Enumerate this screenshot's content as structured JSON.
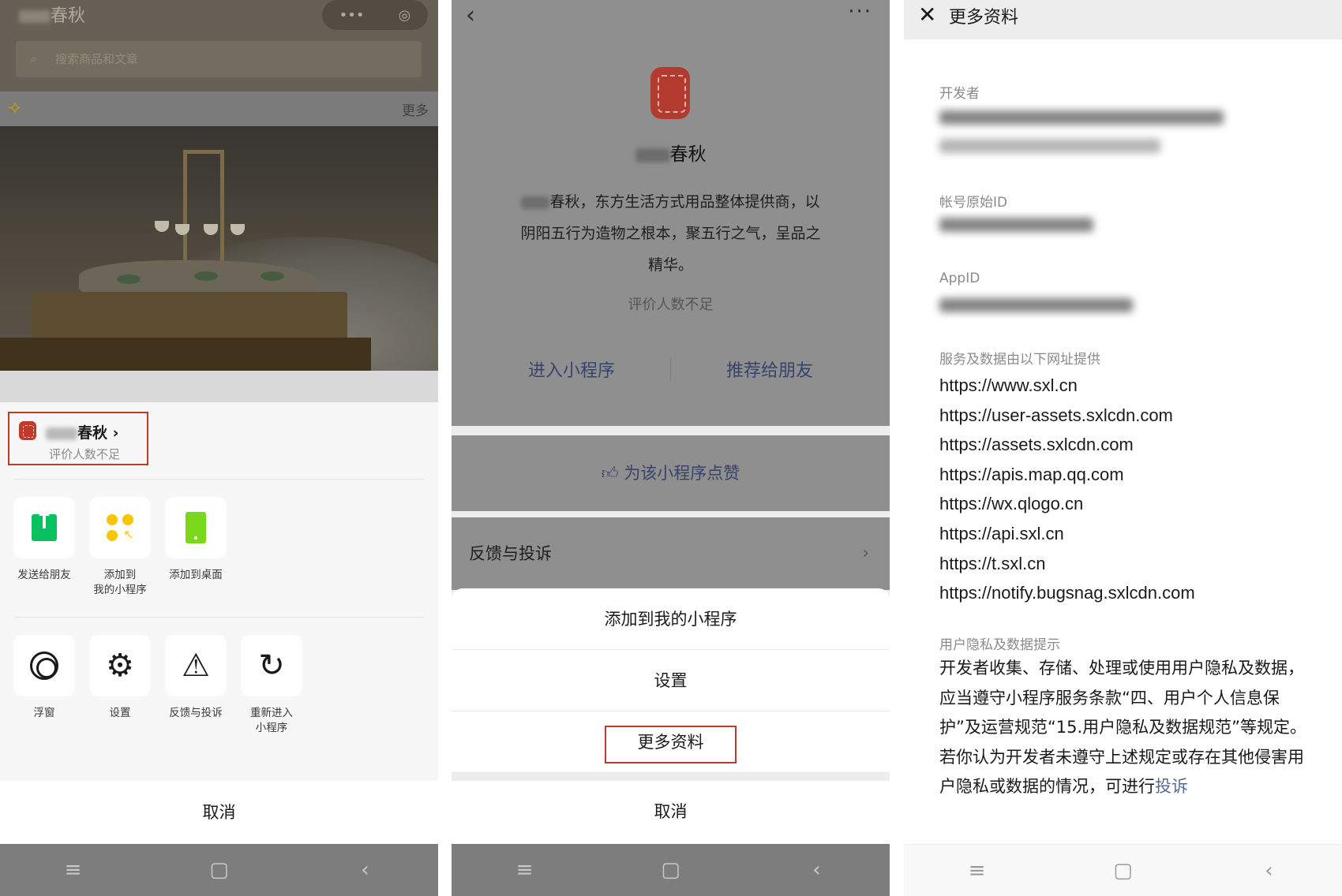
{
  "panel1": {
    "title_suffix": "春秋",
    "capsule": {
      "more_icon": "•••",
      "close_icon": "◎"
    },
    "search_placeholder": "搜索商品和文章",
    "notice_more": "更多",
    "mini_program": {
      "name_suffix": "春秋",
      "chevron": "›",
      "rating": "评价人数不足"
    },
    "row1": [
      {
        "icon": "share-upload-icon",
        "label": "发送给朋友"
      },
      {
        "icon": "add-mini-program-icon",
        "label": "添加到\n我的小程序"
      },
      {
        "icon": "add-desktop-icon",
        "label": "添加到桌面"
      }
    ],
    "row2": [
      {
        "icon": "floating-window-icon",
        "label": "浮窗"
      },
      {
        "icon": "settings-gear-icon",
        "glyph": "⚙",
        "label": "设置"
      },
      {
        "icon": "warning-triangle-icon",
        "glyph": "⚠",
        "label": "反馈与投诉"
      },
      {
        "icon": "refresh-icon",
        "glyph": "↻",
        "label": "重新进入\n小程序"
      }
    ],
    "cancel": "取消"
  },
  "panel2": {
    "back_icon": "‹",
    "more_icon": "···",
    "name_suffix": "春秋",
    "description_line1": "春秋，东方生活方式用品整体提供商，以",
    "description_line2": "阴阳五行为造物之根本，聚五行之气，呈品之",
    "description_line3": "精华。",
    "rating": "评价人数不足",
    "enter_button": "进入小程序",
    "recommend_button": "推荐给朋友",
    "like_label": "为该小程序点赞",
    "feedback_label": "反馈与投诉",
    "feedback_chevron": "›",
    "menu": [
      "添加到我的小程序",
      "设置",
      "更多资料"
    ],
    "cancel": "取消"
  },
  "panel3": {
    "close_icon": "✕",
    "title": "更多资料",
    "developer_label": "开发者",
    "original_id_label": "帐号原始ID",
    "appid_label": "AppID",
    "service_label": "服务及数据由以下网址提供",
    "urls": [
      "https://www.sxl.cn",
      "https://user-assets.sxlcdn.com",
      "https://assets.sxlcdn.com",
      "https://apis.map.qq.com",
      "https://wx.qlogo.cn",
      "https://api.sxl.cn",
      "https://t.sxl.cn",
      "https://notify.bugsnag.sxlcdn.com"
    ],
    "privacy_label": "用户隐私及数据提示",
    "privacy_text": "开发者收集、存储、处理或使用用户隐私及数据，应当遵守小程序服务条款“四、用户个人信息保护”及运营规范“15.用户隐私及数据规范”等规定。若你认为开发者未遵守上述规定或存在其他侵害用户隐私或数据的情况，可进行",
    "privacy_link": "投诉"
  },
  "system_nav": {
    "menu_icon": "≡",
    "home_icon": "▢",
    "back_icon": "‹"
  },
  "colors": {
    "link": "#576b95",
    "highlight_border": "#c0392b",
    "wechat_green": "#07c160",
    "dim_overlay": "#8f8f8f"
  }
}
